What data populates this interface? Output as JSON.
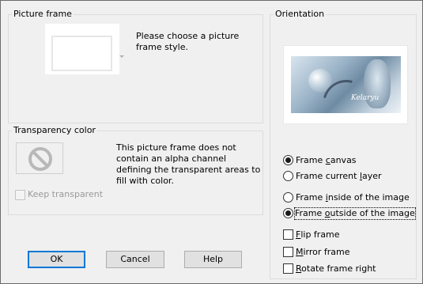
{
  "picture_frame": {
    "title": "Picture frame",
    "description_line1": "Please choose a picture",
    "description_line2": "frame style."
  },
  "transparency": {
    "title": "Transparency color",
    "description_line1": "This picture frame does not",
    "description_line2": "contain an alpha channel",
    "description_line3": "defining the transparent areas to",
    "description_line4": "fill with color.",
    "keep_transparent_label": "Keep transparent",
    "keep_transparent_checked": false,
    "keep_transparent_enabled": false
  },
  "orientation": {
    "title": "Orientation",
    "preview_signature": "Kelaryu",
    "apply_to": [
      {
        "label": "Frame canvas",
        "checked": true
      },
      {
        "label": "Frame current layer",
        "checked": false
      }
    ],
    "placement": [
      {
        "label": "Frame inside of the image",
        "checked": false
      },
      {
        "label": "Frame outside of the image",
        "checked": true
      }
    ],
    "options": [
      {
        "label": "Flip frame",
        "checked": false
      },
      {
        "label": "Mirror frame",
        "checked": false
      },
      {
        "label": "Rotate frame right",
        "checked": false
      }
    ]
  },
  "buttons": {
    "ok": "OK",
    "cancel": "Cancel",
    "help": "Help"
  }
}
